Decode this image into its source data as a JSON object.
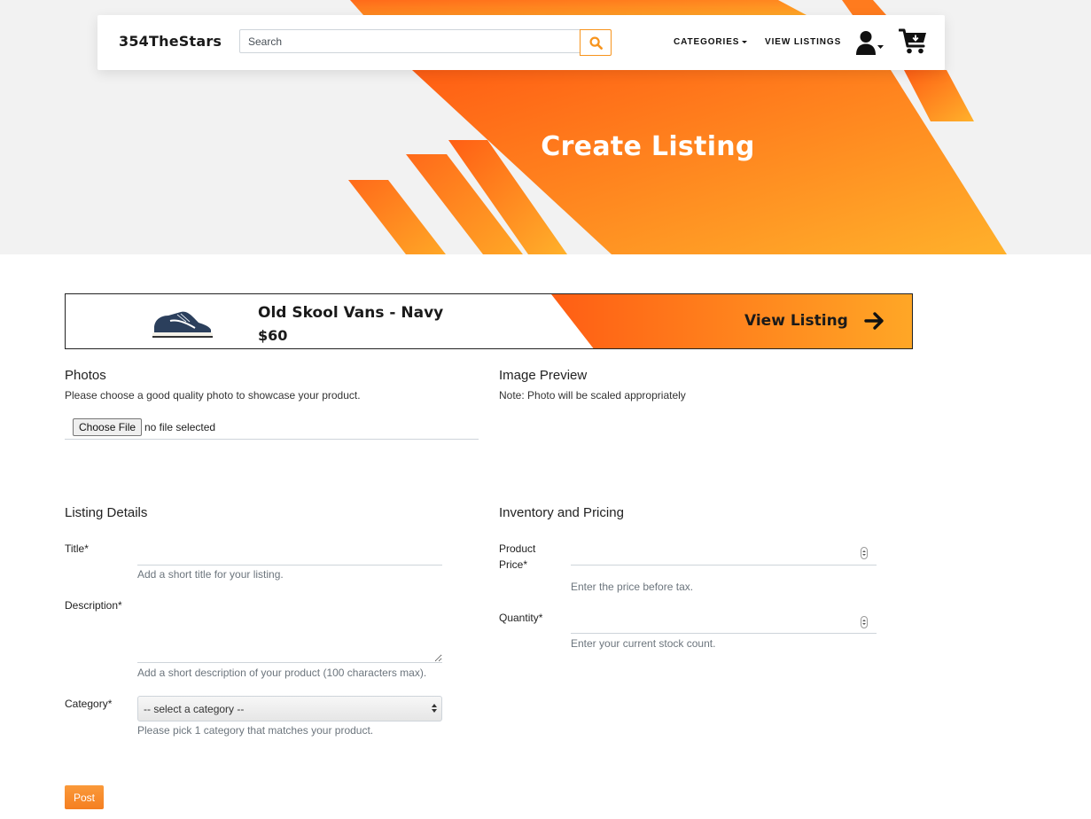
{
  "nav": {
    "brand": "354TheStars",
    "search_placeholder": "Search",
    "categories_label": "CATEGORIES",
    "view_listings_label": "VIEW LISTINGS"
  },
  "hero": {
    "title": "Create Listing"
  },
  "preview": {
    "product_name": "Old Skool Vans - Navy",
    "price": "$60",
    "view_label": "View Listing"
  },
  "photos": {
    "heading": "Photos",
    "help": "Please choose a good quality photo to showcase your product.",
    "choose_file_label": "Choose File",
    "file_status": "no file selected"
  },
  "image_preview": {
    "heading": "Image Preview",
    "note": "Note: Photo will be scaled appropriately"
  },
  "listing_details": {
    "heading": "Listing Details",
    "title_label": "Title*",
    "title_value": "",
    "title_help": "Add a short title for your listing.",
    "description_label": "Description*",
    "description_value": "",
    "description_help": "Add a short description of your product (100 characters max).",
    "category_label": "Category*",
    "category_selected": "-- select a category --",
    "category_help": "Please pick 1 category that matches your product."
  },
  "inventory": {
    "heading": "Inventory and Pricing",
    "price_label_line1": "Product",
    "price_label_line2": "Price*",
    "price_value": "",
    "price_help": "Enter the price before tax.",
    "quantity_label": "Quantity*",
    "quantity_value": "",
    "quantity_help": "Enter your current stock count."
  },
  "actions": {
    "post_label": "Post"
  },
  "colors": {
    "accent": "#f7941d",
    "accent_dark": "#ff5e14",
    "hero_bg": "#f2f2f2"
  },
  "icons": {
    "search": "search-icon",
    "user": "user-icon",
    "cart": "cart-icon",
    "arrow": "arrow-right-icon"
  }
}
